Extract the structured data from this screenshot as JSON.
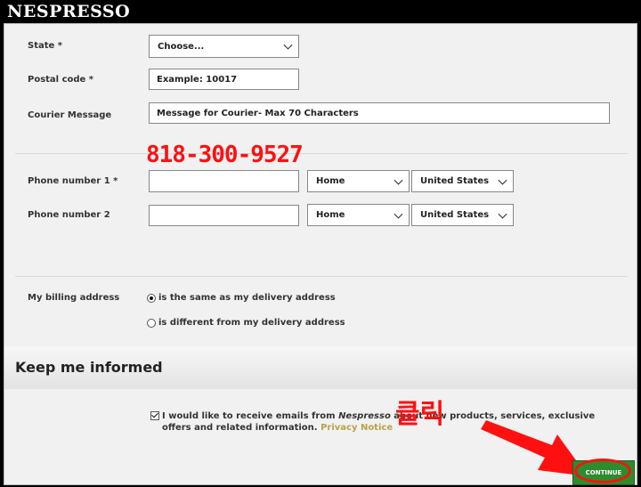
{
  "brand": {
    "logo_text": "NESPRESSO"
  },
  "form": {
    "state": {
      "label": "State *",
      "value": "Choose..."
    },
    "postal": {
      "label": "Postal code *",
      "placeholder": "Example: 10017"
    },
    "courier": {
      "label": "Courier Message",
      "placeholder": "Message for Courier- Max 70 Characters"
    },
    "phone1": {
      "label": "Phone number 1 *",
      "value": "",
      "type": "Home",
      "country": "United States"
    },
    "phone2": {
      "label": "Phone number 2",
      "value": "",
      "type": "Home",
      "country": "United States"
    },
    "billing": {
      "label": "My billing address",
      "option_same": "is the same as my delivery address",
      "option_different": "is different from my delivery address",
      "selected": "same"
    }
  },
  "informed": {
    "title": "Keep me informed",
    "optin_checked": true,
    "optin_text_before": "I would like to receive emails from ",
    "optin_brand": "Nespresso",
    "optin_text_after": " about new products, services, exclusive offers and related information. ",
    "privacy_link": "Privacy Notice"
  },
  "continue_button": {
    "label": "CONTINUE"
  },
  "annotations": {
    "phone_number": "818-300-9527",
    "click_text": "클릭",
    "color": "#ff1010"
  }
}
